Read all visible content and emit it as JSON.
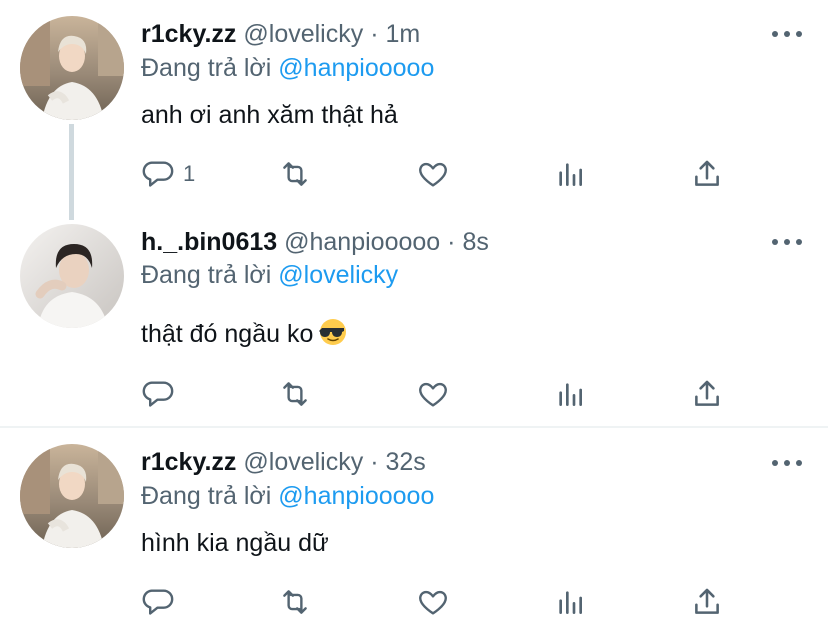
{
  "reply_prefix": "Đang trả lời",
  "tweets": [
    {
      "name": "r1cky.zz",
      "handle": "@lovelicky",
      "separator": "·",
      "time": "1m",
      "reply_to": "@hanpiooooo",
      "text": "anh ơi anh xăm thật hả",
      "reply_count": "1"
    },
    {
      "name": "h._.bin0613",
      "handle": "@hanpiooooo",
      "separator": "·",
      "time": "8s",
      "reply_to": "@lovelicky",
      "text": "thật đó ngầu ko",
      "emoji": "smiling-face-with-sunglasses",
      "reply_count": ""
    },
    {
      "name": "r1cky.zz",
      "handle": "@lovelicky",
      "separator": "·",
      "time": "32s",
      "reply_to": "@hanpiooooo",
      "text": "hình kia ngầu dữ",
      "reply_count": ""
    }
  ],
  "colors": {
    "text": "#0f1419",
    "secondary": "#536471",
    "link": "#1d9bf0",
    "thread_line": "#cfd9de",
    "divider": "#eff3f4"
  }
}
